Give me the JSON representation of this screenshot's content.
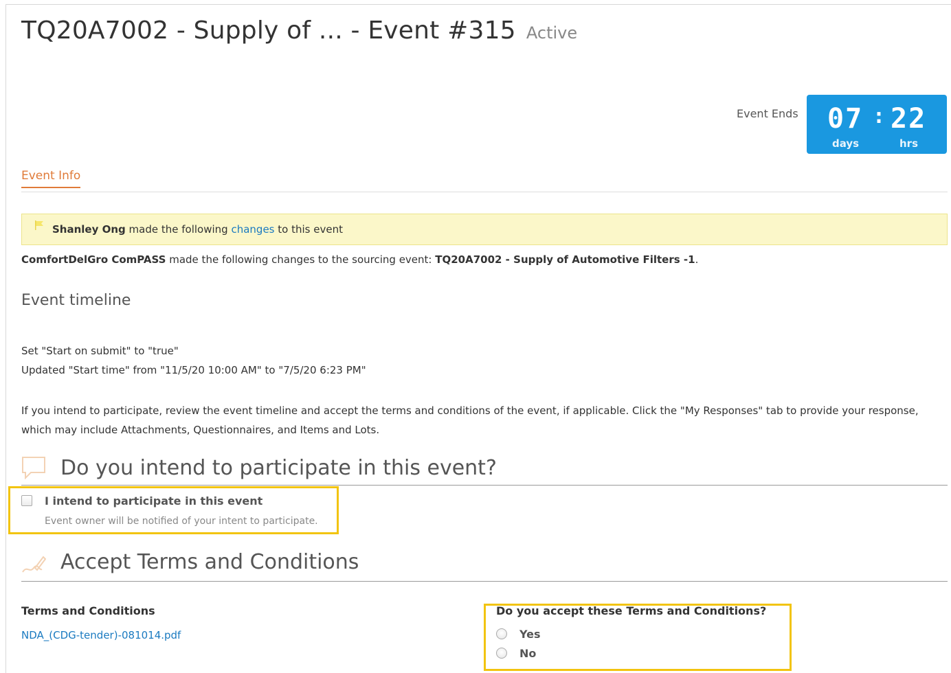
{
  "header": {
    "title": "TQ20A7002 - Supply of ... - Event #315",
    "status": "Active"
  },
  "countdown": {
    "label": "Event Ends",
    "days": "07",
    "hours": "22",
    "days_unit": "days",
    "hours_unit": "hrs",
    "color": "#1a98e0"
  },
  "tabs": [
    {
      "label": "Event Info",
      "active": true
    }
  ],
  "notice": {
    "author": "Shanley Ong",
    "text_before": "made the following",
    "link_label": "changes",
    "text_after": "to this event"
  },
  "change_summary": {
    "org": "ComfortDelGro ComPASS",
    "text": "made the following changes to the sourcing event:",
    "event_name": "TQ20A7002 - Supply of Automotive Filters -1",
    "end": "."
  },
  "timeline": {
    "heading": "Event timeline",
    "line1": "Set \"Start on submit\" to \"true\"",
    "line2": "Updated \"Start time\" from \"11/5/20 10:00 AM\" to \"7/5/20 6:23 PM\""
  },
  "instructions": "If you intend to participate, review the event timeline and accept the terms and conditions of the event, if applicable. Click the \"My Responses\" tab to provide your response, which may include Attachments, Questionnaires, and Items and Lots.",
  "participate": {
    "heading": "Do you intend to participate in this event?",
    "checkbox_label": "I intend to participate in this event",
    "help_text": "Event owner will be notified of your intent to participate.",
    "checked": false
  },
  "terms": {
    "heading": "Accept Terms and Conditions",
    "label": "Terms and Conditions",
    "file": "NDA_(CDG-tender)-081014.pdf",
    "question": "Do you accept these Terms and Conditions?",
    "options": [
      "Yes",
      "No"
    ],
    "selected": null
  },
  "colors": {
    "accent_tab": "#e07b39",
    "link": "#1a7ac0",
    "highlight": "#f2c40f",
    "notice_bg": "#fbf7c9"
  }
}
